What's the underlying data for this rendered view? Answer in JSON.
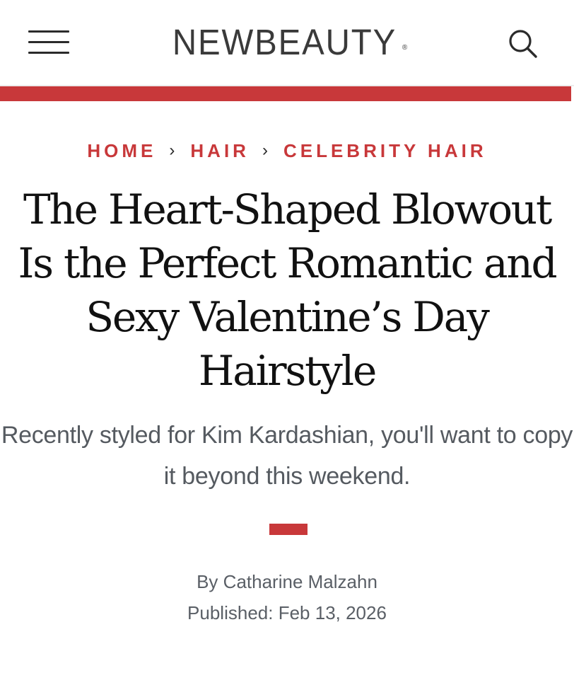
{
  "header": {
    "logo": "NEWBEAUTY",
    "logo_mark": "®",
    "menu_icon": "hamburger-menu-icon",
    "search_icon": "search-icon"
  },
  "colors": {
    "accent": "#c8383a",
    "headline": "#111111",
    "body_text": "#555a60"
  },
  "breadcrumb": {
    "items": [
      {
        "label": "HOME"
      },
      {
        "label": "HAIR"
      },
      {
        "label": "CELEBRITY HAIR"
      }
    ],
    "separator": "›"
  },
  "article": {
    "headline": "The Heart-Shaped Blowout Is the Perfect Romantic and Sexy Valentine’s Day Hairstyle",
    "dek": "Recently styled for Kim Kardashian, you'll want to copy it beyond this weekend.",
    "byline_prefix": "By",
    "author": "Catharine Malzahn",
    "published_label": "Published:",
    "published_date": "Feb 13, 2026"
  }
}
